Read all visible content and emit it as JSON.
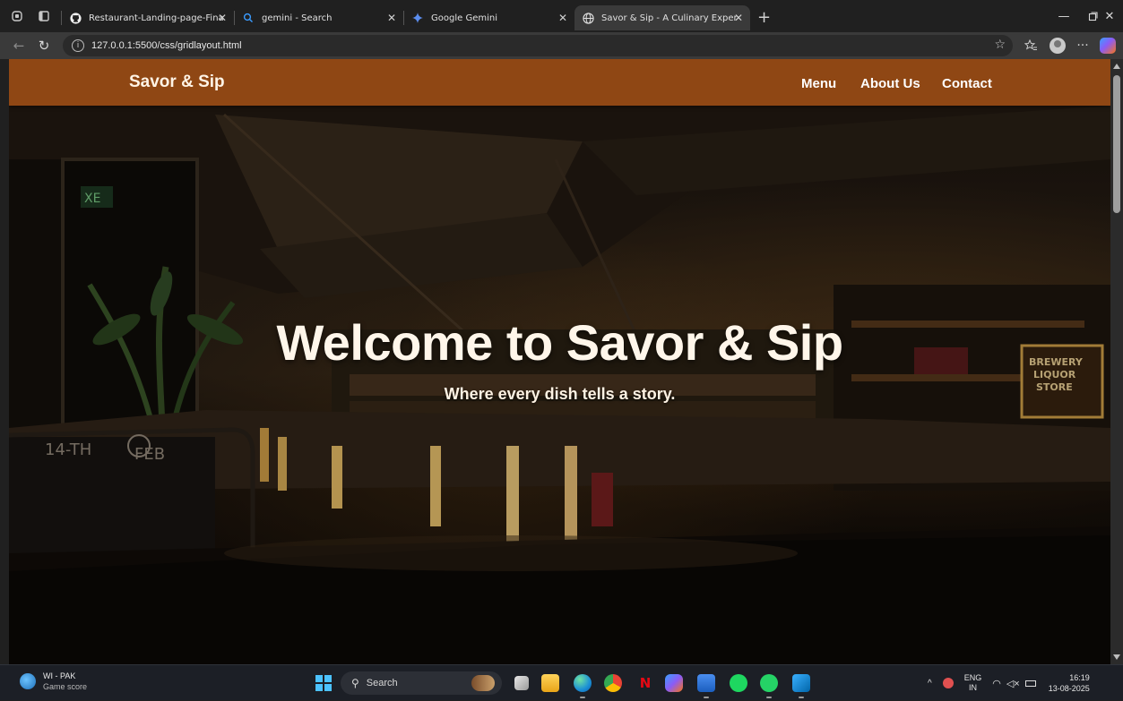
{
  "browser": {
    "tabs": [
      {
        "label": "Restaurant-Landing-page-Final/ir",
        "icon": "github-icon",
        "active": false
      },
      {
        "label": "gemini - Search",
        "icon": "search-icon",
        "active": false
      },
      {
        "label": "Google Gemini",
        "icon": "gemini-icon",
        "active": false
      },
      {
        "label": "Savor & Sip - A Culinary Experien",
        "icon": "globe-icon",
        "active": true
      }
    ],
    "url": "127.0.0.1:5500/css/gridlayout.html"
  },
  "site": {
    "logo": "Savor & Sip",
    "nav": [
      "Menu",
      "About Us",
      "Contact"
    ],
    "header_color": "#8f4714"
  },
  "hero": {
    "title": "Welcome to Savor & Sip",
    "subtitle": "Where every dish tells a story.",
    "sign_line1": "BREWERY",
    "sign_line2": "LIQUOR",
    "sign_line3": "STORE"
  },
  "taskbar": {
    "weather_line1": "WI - PAK",
    "weather_line2": "Game score",
    "search_placeholder": "Search",
    "lang_line1": "ENG",
    "lang_line2": "IN",
    "time": "16:19",
    "date": "13-08-2025"
  }
}
